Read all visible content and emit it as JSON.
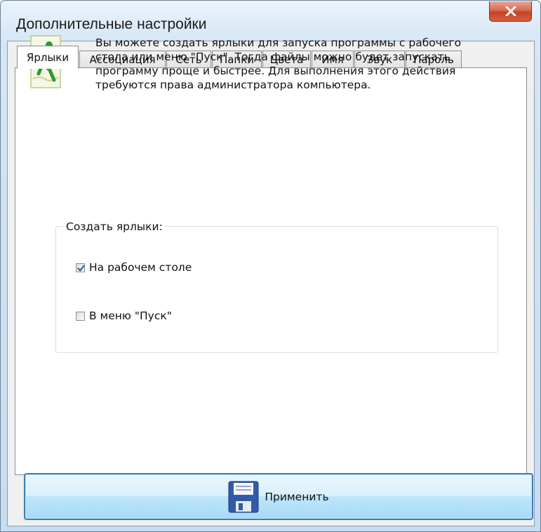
{
  "window": {
    "title": "Дополнительные настройки",
    "close_icon": "close-icon"
  },
  "tabs": [
    {
      "label": "Ярлыки",
      "active": true
    },
    {
      "label": "Ассоциация",
      "active": false
    },
    {
      "label": "Сеть",
      "active": false
    },
    {
      "label": "Папки",
      "active": false
    },
    {
      "label": "Цвета",
      "active": false
    },
    {
      "label": "Имя",
      "active": false
    },
    {
      "label": "Звук",
      "active": false
    },
    {
      "label": "Пароль",
      "active": false
    }
  ],
  "shortcuts_panel": {
    "icon": "runner-icon",
    "intro": "Вы можете создать ярлыки для запуска программы с рабочего стола или меню \"Пуск\". Тогда файлы можно будет запускать программу проще и быстрее. Для выполнения этого действия требуются права администратора компьютера.",
    "group_label": "Создать ярлыки:",
    "options": [
      {
        "label": "На рабочем столе",
        "checked": true
      },
      {
        "label": "В меню \"Пуск\"",
        "checked": false
      }
    ]
  },
  "apply_button": {
    "label": "Применить",
    "icon": "floppy-disk-icon"
  },
  "colors": {
    "accent_border": "#3c7fb1",
    "close_red": "#c44226",
    "runner_green": "#2e9a2e"
  }
}
